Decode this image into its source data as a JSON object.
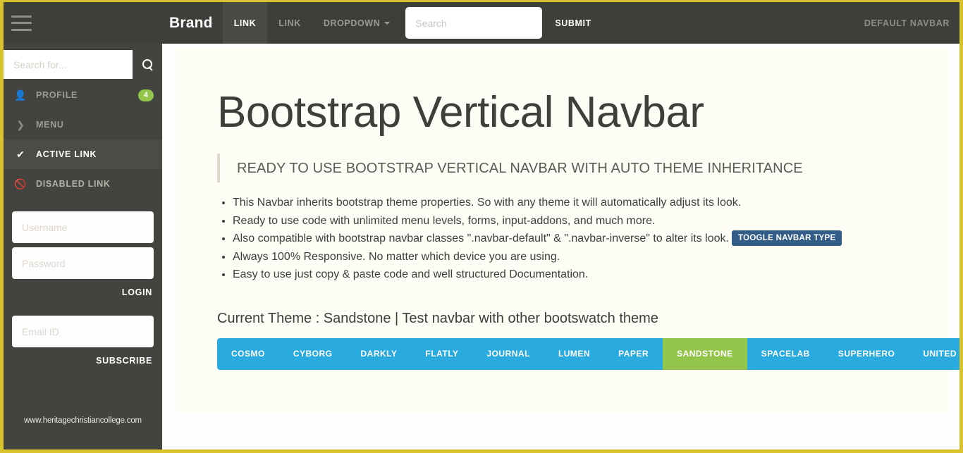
{
  "topnav": {
    "hamburger_icon": "hamburger-icon",
    "brand": "Brand",
    "links": [
      {
        "label": "LINK",
        "active": true
      },
      {
        "label": "LINK",
        "active": false
      },
      {
        "label": "DROPDOWN",
        "active": false,
        "caret": true
      }
    ],
    "search_placeholder": "Search",
    "search_value": "",
    "submit_label": "SUBMIT",
    "right_label": "DEFAULT NAVBAR",
    "background_color": "#3e3f3a"
  },
  "sidebar": {
    "search_placeholder": "Search for...",
    "search_value": "",
    "search_icon": "search-icon",
    "items": [
      {
        "label": "PROFILE",
        "icon": "user-icon",
        "badge": "4",
        "state": "normal"
      },
      {
        "label": "MENU",
        "icon": "chevron-right-icon",
        "badge": "",
        "state": "normal"
      },
      {
        "label": "ACTIVE LINK",
        "icon": "check-icon",
        "badge": "",
        "state": "active"
      },
      {
        "label": "DISABLED LINK",
        "icon": "eye-slash-icon",
        "badge": "",
        "state": "disabled"
      }
    ],
    "login_form": {
      "username_placeholder": "Username",
      "username_value": "",
      "password_placeholder": "Password",
      "password_value": "",
      "submit_label": "LOGIN"
    },
    "subscribe_form": {
      "email_placeholder": "Email ID",
      "email_value": "",
      "submit_label": "SUBSCRIBE"
    },
    "watermark": "www.heritagechristiancollege.com",
    "background_color": "#43443f",
    "badge_color": "#93c54b"
  },
  "main": {
    "heading": "Bootstrap Vertical Navbar",
    "lead": "READY TO USE BOOTSTRAP VERTICAL NAVBAR WITH AUTO THEME INHERITANCE",
    "features": [
      "This Navbar inherits bootstrap theme properties. So with any theme it will automatically adjust its look.",
      "Ready to use code with unlimited menu levels, forms, input-addons, and much more.",
      "Also compatible with bootstrap navbar classes \".navbar-default\" & \".navbar-inverse\" to alter its look.",
      "Always 100% Responsive. No matter which device you are using.",
      "Easy to use just copy & paste code and well structured Documentation."
    ],
    "toggle_button_label": "TOOGLE NAVBAR TYPE",
    "toggle_button_color": "#325d88",
    "current_theme_line": "Current Theme : Sandstone | Test navbar with other bootswatch theme",
    "themes": [
      {
        "label": "COSMO",
        "selected": false
      },
      {
        "label": "CYBORG",
        "selected": false
      },
      {
        "label": "DARKLY",
        "selected": false
      },
      {
        "label": "FLATLY",
        "selected": false
      },
      {
        "label": "JOURNAL",
        "selected": false
      },
      {
        "label": "LUMEN",
        "selected": false
      },
      {
        "label": "PAPER",
        "selected": false
      },
      {
        "label": "SANDSTONE",
        "selected": true
      },
      {
        "label": "SPACELAB",
        "selected": false
      },
      {
        "label": "SUPERHERO",
        "selected": false
      },
      {
        "label": "UNITED",
        "selected": false
      }
    ],
    "theme_button_color": "#29abe0",
    "theme_selected_color": "#93c54b"
  },
  "page": {
    "border_color": "#d8c22e",
    "panel_color": "#fdfcf5"
  }
}
